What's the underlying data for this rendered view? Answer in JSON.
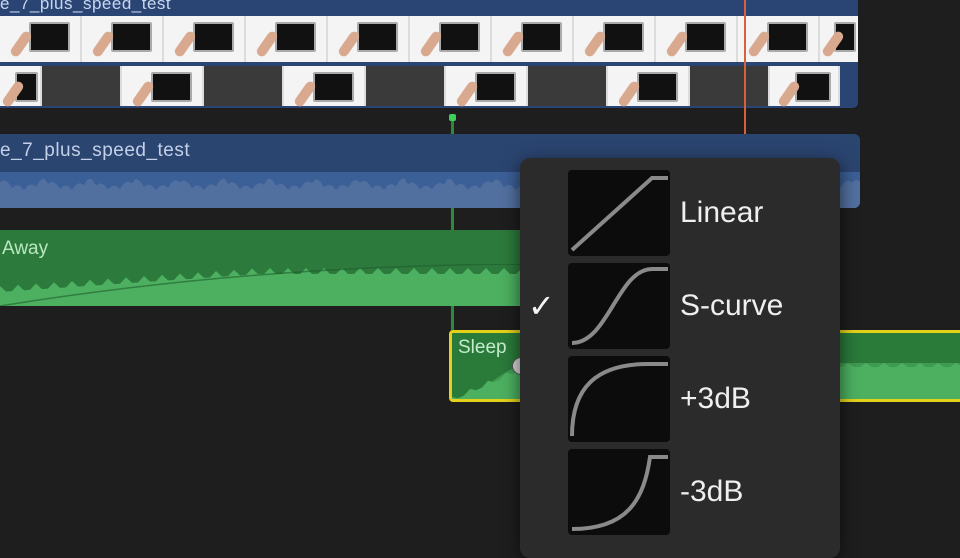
{
  "timeline": {
    "video_clip_title": "e_7_plus_speed_test",
    "audio_clip_title": "e_7_plus_speed_test",
    "music_clip_title": "Away",
    "selected_clip_title": "Sleep"
  },
  "fade_menu": {
    "items": [
      {
        "label": "Linear",
        "checked": false,
        "curve_icon": "linear-curve-icon"
      },
      {
        "label": "S-curve",
        "checked": true,
        "curve_icon": "s-curve-icon"
      },
      {
        "label": "+3dB",
        "checked": false,
        "curve_icon": "plus-3db-curve-icon"
      },
      {
        "label": "-3dB",
        "checked": false,
        "curve_icon": "minus-3db-curve-icon"
      }
    ],
    "check_glyph": "✓"
  },
  "colors": {
    "video_clip": "#2a4574",
    "audio_clip": "#2b4571",
    "music_clip": "#2c7a3c",
    "selection_border": "#e5d11a",
    "playhead": "#d8603a"
  }
}
